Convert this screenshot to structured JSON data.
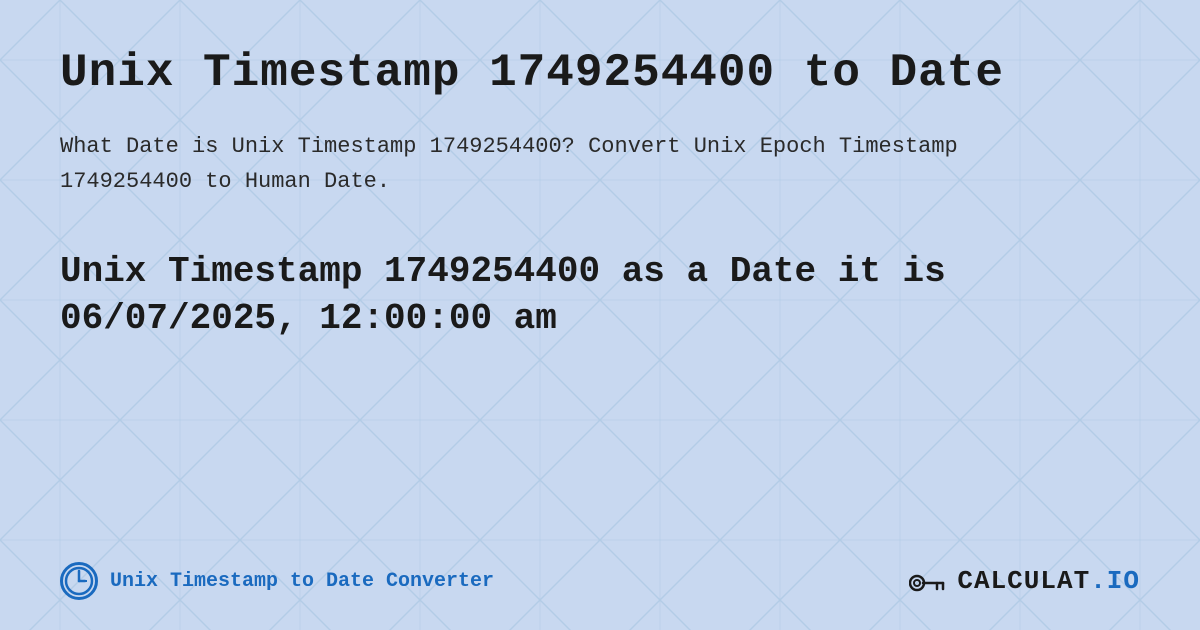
{
  "page": {
    "background_color": "#c8d8f0",
    "main_title": "Unix Timestamp 1749254400 to Date",
    "description": "What Date is Unix Timestamp 1749254400? Convert Unix Epoch Timestamp 1749254400 to Human Date.",
    "result_line1": "Unix Timestamp 1749254400 as a Date it is",
    "result_line2": "06/07/2025, 12:00:00 am",
    "footer": {
      "link_text": "Unix Timestamp to Date Converter",
      "logo_text": "CALCULAT.IO"
    }
  }
}
